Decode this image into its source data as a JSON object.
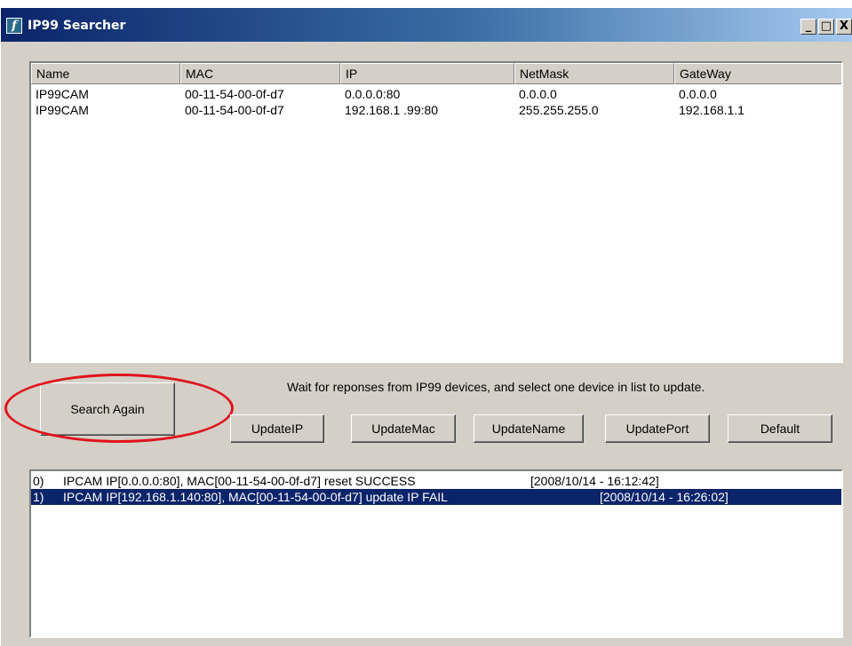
{
  "window": {
    "title": "IP99 Searcher",
    "app_icon": "app-icon",
    "controls": {
      "minimize": "_",
      "maximize": "□",
      "close": "X"
    }
  },
  "device_list": {
    "columns": [
      "Name",
      "MAC",
      "IP",
      "NetMask",
      "GateWay"
    ],
    "rows": [
      [
        "IP99CAM",
        "00-11-54-00-0f-d7",
        "0.0.0.0:80",
        "0.0.0.0",
        "0.0.0.0"
      ],
      [
        "IP99CAM",
        "00-11-54-00-0f-d7",
        "192.168.1 .99:80",
        "255.255.255.0",
        "192.168.1.1"
      ]
    ]
  },
  "hint_text": "Wait for reponses from IP99 devices, and select one device in list to update.",
  "buttons": {
    "search_again": "Search Again",
    "update_ip": "UpdateIP",
    "update_mac": "UpdateMac",
    "update_name": "UpdateName",
    "update_port": "UpdatePort",
    "default": "Default"
  },
  "log": {
    "entries": [
      {
        "index": "0)",
        "message": "IPCAM IP[0.0.0.0:80], MAC[00-11-54-00-0f-d7] reset SUCCESS",
        "time": "[2008/10/14 - 16:12:42]",
        "selected": false
      },
      {
        "index": "1)",
        "message": "IPCAM IP[192.168.1.140:80], MAC[00-11-54-00-0f-d7] update IP FAIL",
        "time": "[2008/10/14 - 16:26:02]",
        "selected": true
      }
    ]
  },
  "colors": {
    "face": "#d4d0c8",
    "selection": "#0a246a",
    "title_gradient_start": "#0a246a",
    "callout": "#e0141c"
  }
}
